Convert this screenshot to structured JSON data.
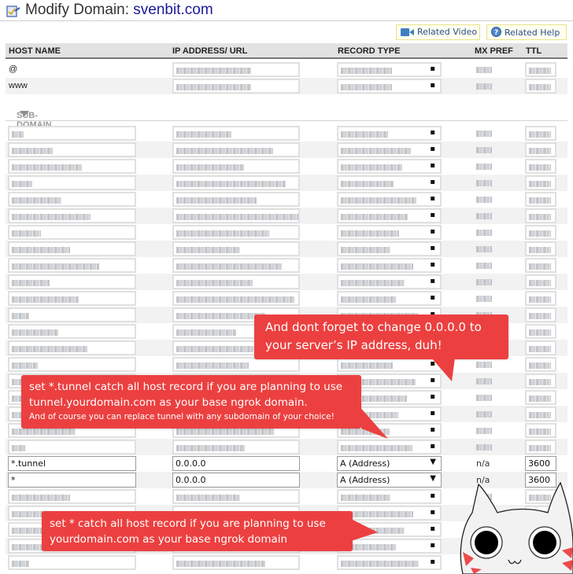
{
  "header": {
    "title_prefix": "Modify Domain: ",
    "domain": "svenbit.com",
    "title_icon": "edit-document-icon"
  },
  "toolbar": {
    "related_video_label": "Related Video",
    "related_video_icon": "video-camera-icon",
    "related_help_label": "Related Help",
    "related_help_icon": "help-circle-icon"
  },
  "columns": {
    "host": "HOST NAME",
    "ip": "IP ADDRESS/ URL",
    "type": "RECORD TYPE",
    "mx": "MX PREF",
    "ttl": "TTL"
  },
  "main_records": [
    {
      "host": "@",
      "ip": "[redacted]",
      "type": "[redacted]",
      "mx": "[redacted]",
      "ttl": "[redacted]"
    },
    {
      "host": "www",
      "ip": "[redacted]",
      "type": "[redacted]",
      "mx": "[redacted]",
      "ttl": "[redacted]"
    }
  ],
  "subdomain_section": {
    "label": "SUB-DOMAIN SETTINGS"
  },
  "subdomain_rows_before": 20,
  "highlighted_records": [
    {
      "host": "*.tunnel",
      "ip": "0.0.0.0",
      "type": "A (Address)",
      "mx": "n/a",
      "ttl": "3600"
    },
    {
      "host": "*",
      "ip": "0.0.0.0",
      "type": "A (Address)",
      "mx": "n/a",
      "ttl": "3600"
    }
  ],
  "subdomain_rows_after": 5,
  "redacted_note": "Other record values are blurred in the screenshot",
  "callouts": {
    "ip_reminder": "And dont forget to change 0.0.0.0 to your server’s IP address, duh!",
    "tunnel_line1": "set *.tunnel catch all host record if you are planning to use",
    "tunnel_line2": "tunnel.yourdomain.com as your base ngrok domain.",
    "tunnel_line3": "And of course you can replace tunnel with any subdomain of your choice!",
    "wildcard_line1": "set * catch all host record if you are planning to use",
    "wildcard_line2": "yourdomain.com as your base ngrok domain"
  },
  "colors": {
    "callout": "#ec4040",
    "domain_link": "#1a1a9a",
    "related_bg": "#fffff0",
    "related_border": "#e8e48a"
  },
  "decoration": "cartoon-cat-mascot"
}
